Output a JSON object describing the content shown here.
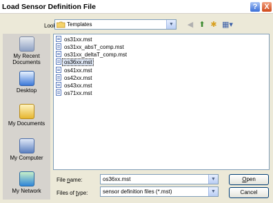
{
  "window": {
    "title": "Load Sensor Definition File",
    "help_label": "?",
    "close_label": "X"
  },
  "lookin": {
    "label": "Look in:",
    "value": "Templates",
    "arrow": "▼"
  },
  "toolbar": {
    "back_icon": "◀",
    "up_icon": "⬆",
    "new_folder_icon": "✱",
    "views_icon": "▦▾"
  },
  "places": [
    {
      "label": "My Recent Documents",
      "icon": "recent-documents-icon"
    },
    {
      "label": "Desktop",
      "icon": "desktop-icon"
    },
    {
      "label": "My Documents",
      "icon": "my-documents-icon"
    },
    {
      "label": "My Computer",
      "icon": "my-computer-icon"
    },
    {
      "label": "My Network",
      "icon": "my-network-icon"
    }
  ],
  "files": [
    {
      "name": "os31xx.mst",
      "selected": false
    },
    {
      "name": "os31xx_absT_comp.mst",
      "selected": false
    },
    {
      "name": "os31xx_deltaT_comp.mst",
      "selected": false
    },
    {
      "name": "os36xx.mst",
      "selected": true
    },
    {
      "name": "os41xx.mst",
      "selected": false
    },
    {
      "name": "os42xx.mst",
      "selected": false
    },
    {
      "name": "os43xx.mst",
      "selected": false
    },
    {
      "name": "os71xx.mst",
      "selected": false
    }
  ],
  "filename": {
    "label_prefix": "File ",
    "label_underlined": "n",
    "label_suffix": "ame:",
    "value": "os36xx.mst",
    "arrow": "▼"
  },
  "filetype": {
    "label_prefix": "Files of ",
    "label_underlined": "t",
    "label_suffix": "ype:",
    "value": "sensor definition files (*.mst)",
    "arrow": "▼"
  },
  "buttons": {
    "open_underlined": "O",
    "open_rest": "pen",
    "cancel": "Cancel"
  }
}
